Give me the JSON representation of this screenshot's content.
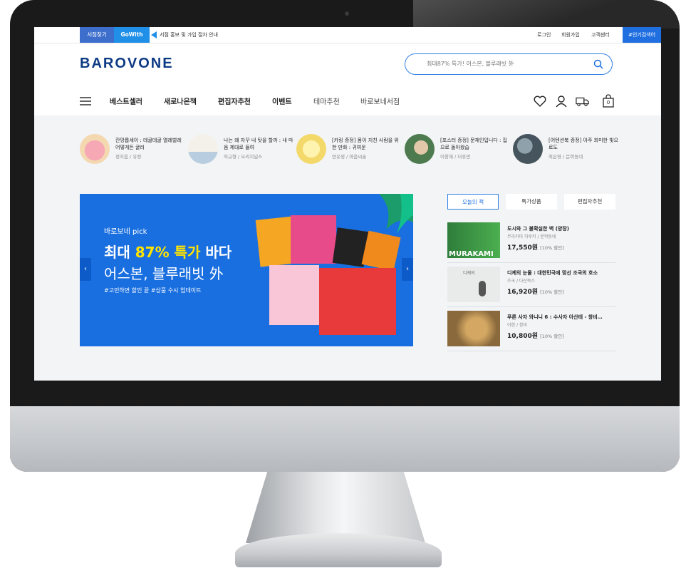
{
  "topbar": {
    "store_find": "서점찾기",
    "gowith": "GoWith",
    "notice": "서점 홍보 및 가입 절차 안내",
    "login": "로그인",
    "signup": "회원가입",
    "support": "고객센터",
    "hot_search": "#인기검색어"
  },
  "header": {
    "logo": "BAROVONE",
    "search_placeholder": "최대87% 특가! 어스본, 블루래빗 外",
    "search_icon": "search-icon"
  },
  "nav": {
    "items": [
      {
        "label": "베스트셀러"
      },
      {
        "label": "새로나온책"
      },
      {
        "label": "편집자추천"
      },
      {
        "label": "이벤트"
      },
      {
        "label": "테마추천"
      },
      {
        "label": "바로보네서점"
      }
    ],
    "icons": [
      "heart-icon",
      "user-icon",
      "truck-icon",
      "cart-icon"
    ],
    "cart_count": "0"
  },
  "featured": [
    {
      "title": "잔망룹셰이 : 데굴데굴 열레벌레 어떻게든 굴러",
      "author": "정지음 / 유령"
    },
    {
      "title": "나는 왜 자꾸 내 탓을 할까 : 내 마음 제대로 들여",
      "author": "허규형 / 오리지널스"
    },
    {
      "title": "[카링 증정] 몸이 지친 사람을 위한 만화 : 귀여운",
      "author": "연유생 / 마음씨술"
    },
    {
      "title": "[포스터 증정] 문재인입니다 : 집으로 돌아왔습",
      "author": "이창재 / 더휴먼"
    },
    {
      "title": "[어텐션북 증정] 아주 희미한 빛으로도",
      "author": "최은영 / 문학동네"
    }
  ],
  "banner": {
    "pick": "바로보네 pick",
    "headline_pre": "최대 ",
    "headline_hl": "87% 특가",
    "headline_post": " 바다",
    "subline": "어스본, 블루래빗 外",
    "tags": "#고민하면 할인 끝  #상품 수시 업데이트",
    "prev": "‹",
    "next": "›",
    "colors": {
      "bg": "#1a6fe0",
      "highlight": "#ffe400"
    }
  },
  "side": {
    "tabs": [
      "오늘의 책",
      "특가상품",
      "편집자추천"
    ],
    "books": [
      {
        "title": "도시와 그 불확실한 벽 (양장)",
        "author": "무라카미 하루키 / 문학동네",
        "price": "17,550원",
        "discount": "[10% 할인]",
        "cover_text": "MURAKAMI"
      },
      {
        "title": "디케의 눈물 : 대한민국에 맞선 조국의 호소",
        "author": "조국 / 다산북스",
        "price": "16,920원",
        "discount": "[10% 할인]",
        "cover_text": "디케의"
      },
      {
        "title": "푸른 사자 와니니 6 : 수사자 아산테 - 창비…",
        "author": "이현 / 창비",
        "price": "10,800원",
        "discount": "[10% 할인]",
        "cover_text": ""
      }
    ]
  }
}
